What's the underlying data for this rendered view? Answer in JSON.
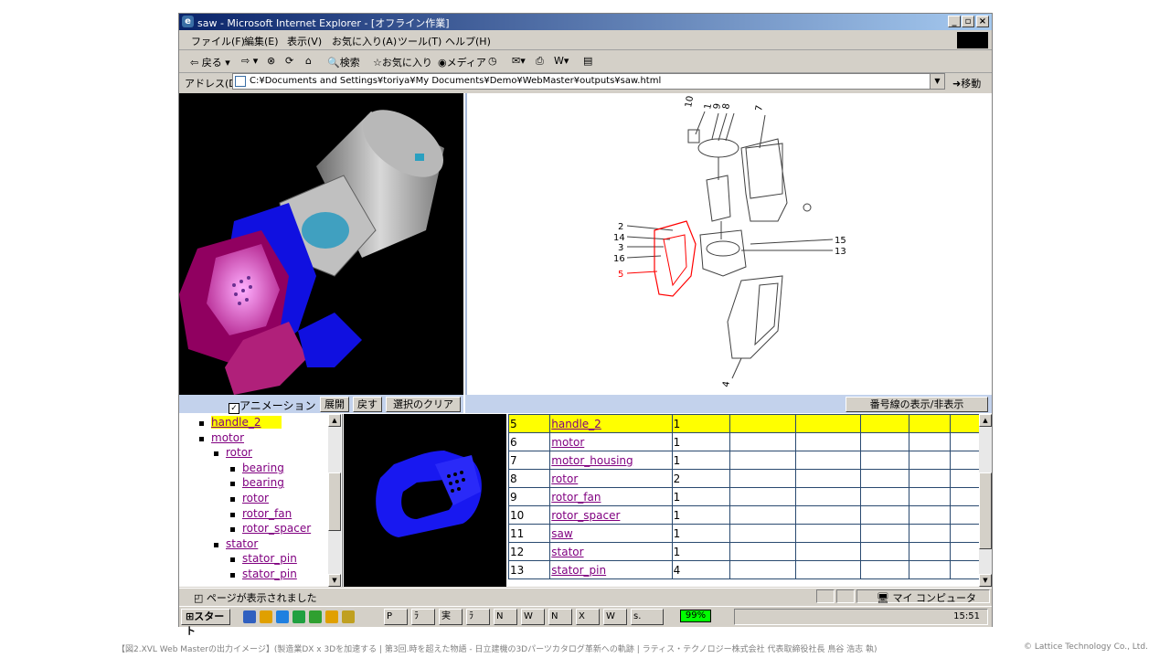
{
  "window": {
    "title": "saw - Microsoft Internet Explorer - [オフライン作業]",
    "buttons": [
      "_",
      "▫",
      "×"
    ]
  },
  "menu": [
    "ファイル(F)",
    "編集(E)",
    "表示(V)",
    "お気に入り(A)",
    "ツール(T)",
    "ヘルプ(H)"
  ],
  "toolbar": {
    "back": "戻る",
    "search": "検索",
    "favorites": "お気に入り",
    "media": "メディア"
  },
  "address": {
    "label": "アドレス(D)",
    "url": "C:¥Documents and Settings¥toriya¥My Documents¥Demo¥WebMaster¥outputs¥saw.html",
    "go": "移動"
  },
  "controls": {
    "animation_label": "アニメーション",
    "animation_checked": "✓",
    "expand": "展開",
    "back": "戻す",
    "clear_selection": "選択のクリア",
    "toggle_callouts": "番号線の表示/非表示"
  },
  "drawing": {
    "callouts_top": [
      "10",
      "1",
      "9",
      "8",
      "7"
    ],
    "callouts_left": [
      "2",
      "14",
      "3",
      "16",
      "5"
    ],
    "callouts_right": [
      "15",
      "13"
    ],
    "callout_bottom": "4",
    "highlight_color": "#ff0000"
  },
  "tree": [
    {
      "label": "handle_2",
      "level": 1,
      "selected": true
    },
    {
      "label": "motor",
      "level": 1
    },
    {
      "label": "rotor",
      "level": 2
    },
    {
      "label": "bearing",
      "level": 3
    },
    {
      "label": "bearing",
      "level": 3
    },
    {
      "label": "rotor",
      "level": 3
    },
    {
      "label": "rotor_fan",
      "level": 3
    },
    {
      "label": "rotor_spacer",
      "level": 3
    },
    {
      "label": "stator",
      "level": 2
    },
    {
      "label": "stator_pin",
      "level": 3
    },
    {
      "label": "stator_pin",
      "level": 3
    }
  ],
  "parts_table": [
    {
      "no": "5",
      "name": "handle_2",
      "qty": "1",
      "selected": true
    },
    {
      "no": "6",
      "name": "motor",
      "qty": "1"
    },
    {
      "no": "7",
      "name": "motor_housing",
      "qty": "1"
    },
    {
      "no": "8",
      "name": "rotor",
      "qty": "2"
    },
    {
      "no": "9",
      "name": "rotor_fan",
      "qty": "1"
    },
    {
      "no": "10",
      "name": "rotor_spacer",
      "qty": "1"
    },
    {
      "no": "11",
      "name": "saw",
      "qty": "1"
    },
    {
      "no": "12",
      "name": "stator",
      "qty": "1"
    },
    {
      "no": "13",
      "name": "stator_pin",
      "qty": "4"
    }
  ],
  "status": {
    "message": "ページが表示されました",
    "zone": "マイ コンピュータ"
  },
  "taskbar": {
    "start": "スタート",
    "tasks": [
      "P",
      "ﾗ",
      "実",
      "ﾗ",
      "N",
      "W",
      "N",
      "X",
      "W",
      "s."
    ],
    "battery": "99%",
    "clock": "15:51"
  },
  "caption": "【図2.XVL Web Masterの出力イメージ】(製造業DX x 3Dを加速する | 第3回.時を超えた物語 - 日立建機の3Dパーツカタログ革新への軌跡 | ラティス・テクノロジー株式会社 代表取締役社長 鳥谷 浩志 執)",
  "copyright": "© Lattice Technology Co., Ltd."
}
